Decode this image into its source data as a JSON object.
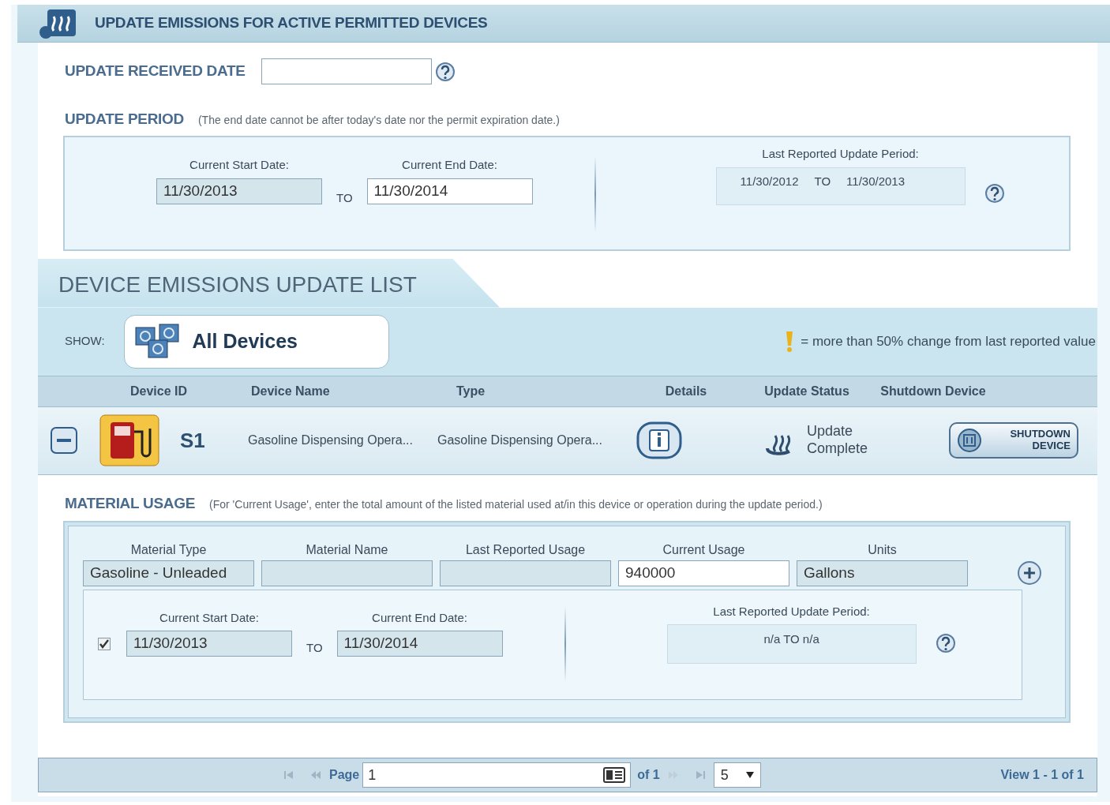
{
  "header": {
    "title": "UPDATE EMISSIONS FOR ACTIVE PERMITTED DEVICES"
  },
  "received_date": {
    "label": "UPDATE RECEIVED DATE"
  },
  "update_period": {
    "label": "UPDATE PERIOD",
    "note": "(The end date cannot be after today's date nor the permit expiration date.)",
    "start_label": "Current Start Date:",
    "start_value": "11/30/2013",
    "start_disabled": true,
    "to": "TO",
    "end_label": "Current End Date:",
    "end_value": "11/30/2014",
    "end_disabled": false,
    "last_label": "Last Reported Update Period:",
    "last_start": "11/30/2012",
    "last_to": "TO",
    "last_end": "11/30/2013"
  },
  "device_list": {
    "title": "DEVICE EMISSIONS UPDATE LIST",
    "show_label": "SHOW:",
    "filter": "All Devices",
    "legend": "= more than 50% change from last reported value",
    "columns": [
      "Device ID",
      "Device Name",
      "Type",
      "Details",
      "Update Status",
      "Shutdown Device"
    ],
    "rows": [
      {
        "expanded": true,
        "device_id": "S1",
        "device_name": "Gasoline Dispensing Opera...",
        "type": "Gasoline Dispensing Opera...",
        "status": "Update Complete",
        "shutdown": "SHUTDOWN DEVICE"
      }
    ]
  },
  "material_usage": {
    "label": "MATERIAL USAGE",
    "note": "(For 'Current Usage', enter the total amount of the listed material used at/in this device or operation during the update period.)",
    "columns": [
      "Material Type",
      "Material Name",
      "Last Reported Usage",
      "Current Usage",
      "Units"
    ],
    "materials": [
      {
        "fields": [
          {
            "value": "Gasoline - Unleaded",
            "disabled": true
          },
          {
            "disabled": true
          },
          {
            "disabled": true
          },
          {
            "value": "940000",
            "disabled": false
          },
          {
            "value": "Gallons",
            "disabled": true
          }
        ],
        "checked": true,
        "start_label": "Current Start Date:",
        "start_value": "11/30/2013",
        "start_disabled": true,
        "to": "TO",
        "end_label": "Current End Date:",
        "end_value": "11/30/2014",
        "end_disabled": true,
        "last_label": "Last Reported Update Period:",
        "last_period": "n/a TO n/a"
      }
    ]
  },
  "pager": {
    "page_label": "Page",
    "page": "1",
    "of": "of 1",
    "page_size": "5",
    "view": "View 1 - 1 of 1"
  }
}
